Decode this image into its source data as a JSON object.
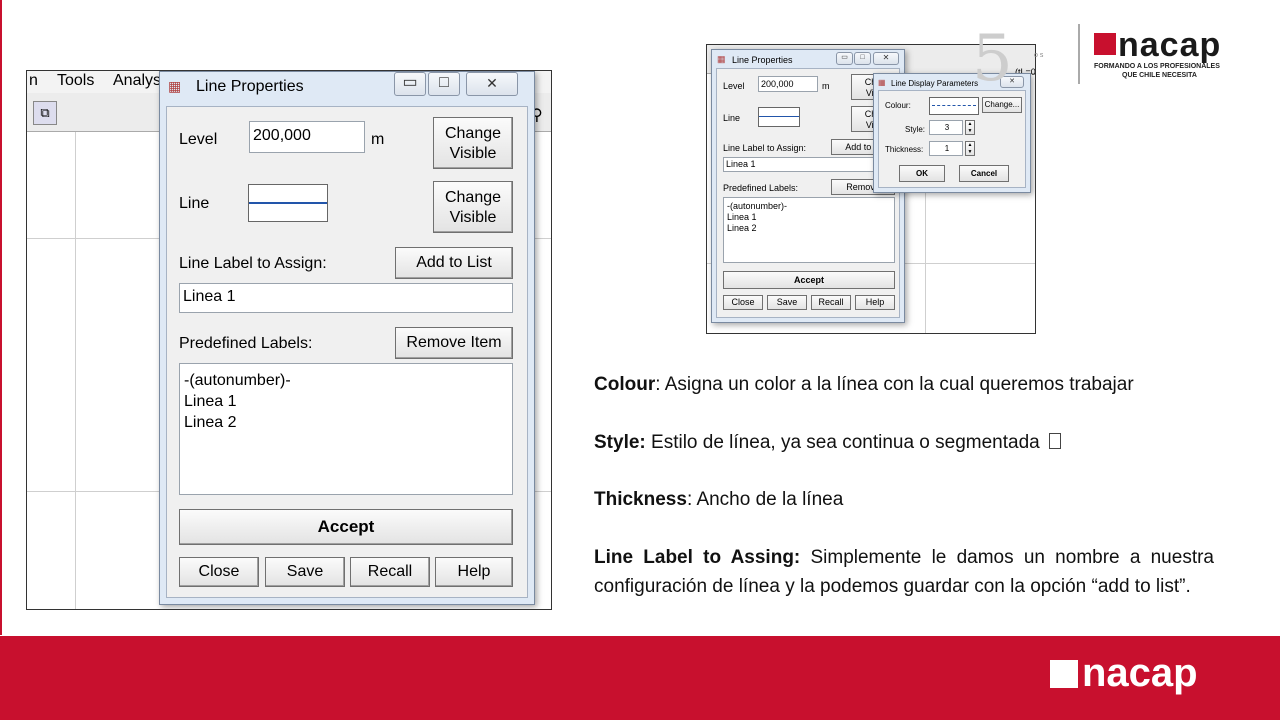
{
  "big_window": {
    "menu": {
      "item_n": "n",
      "tools": "Tools",
      "analysis": "Analys"
    },
    "title": "Line Properties",
    "level_label": "Level",
    "level_value": "200,000",
    "level_unit": "m",
    "change_visible_1": [
      "Change",
      "Visible"
    ],
    "line_label": "Line",
    "change_visible_2": [
      "Change",
      "Visible"
    ],
    "line_label_assign": "Line Label to Assign:",
    "add_to_list": "Add to List",
    "label_value": "Linea 1",
    "predefined_labels": "Predefined Labels:",
    "remove_item": "Remove Item",
    "list_items": [
      "-(autonumber)-",
      "Linea 1",
      "Linea 2"
    ],
    "accept": "Accept",
    "close": "Close",
    "save": "Save",
    "recall": "Recall",
    "help": "Help"
  },
  "small_window": {
    "title": "Line Properties",
    "level_label": "Level",
    "level_value": "200,000",
    "level_unit": "m",
    "change_1": [
      "Cha",
      "Visi"
    ],
    "line_label": "Line",
    "change_2": [
      "Cha",
      "Visi"
    ],
    "line_label_assign": "Line Label to Assign:",
    "add_to_list": "Add to Li",
    "label_value": "Linea 1",
    "predefined_labels": "Predefined Labels:",
    "remove_item": "Remove",
    "list_items": [
      "-(autonumber)-",
      "Linea 1",
      "Linea 2"
    ],
    "accept": "Accept",
    "close": "Close",
    "save": "Save",
    "recall": "Recall",
    "help": "Help",
    "bg_text": "(tL=0"
  },
  "params_dialog": {
    "title": "Line Display Parameters",
    "colour_label": "Colour:",
    "change_button": "Change...",
    "style_label": "Style:",
    "style_value": "3",
    "thickness_label": "Thickness:",
    "thickness_value": "1",
    "ok": "OK",
    "cancel": "Cancel"
  },
  "text": {
    "colour_term": "Colour",
    "colour_desc": ": Asigna un color a la línea con la cual queremos trabajar",
    "style_term": "Style:",
    "style_desc": " Estilo de línea, ya sea continua o segmentada ",
    "thickness_term": "Thickness",
    "thickness_desc": ": Ancho de la línea",
    "assign_term": "Line Label to Assing:",
    "assign_desc": " Simplemente le damos un nombre a nuestra configuración de línea y la podemos guardar con la opción “add to list”."
  },
  "logo": {
    "name": "nacap",
    "subtitle_1": "FORMANDO A LOS PROFESIONALES",
    "subtitle_2": "QUE CHILE NECESITA",
    "fifty": "5",
    "fifty_small": "o s"
  },
  "footer": {
    "name": "nacap"
  },
  "colors": {
    "brand_red": "#c8102e",
    "dialog_blue": "#dfe9f5"
  }
}
